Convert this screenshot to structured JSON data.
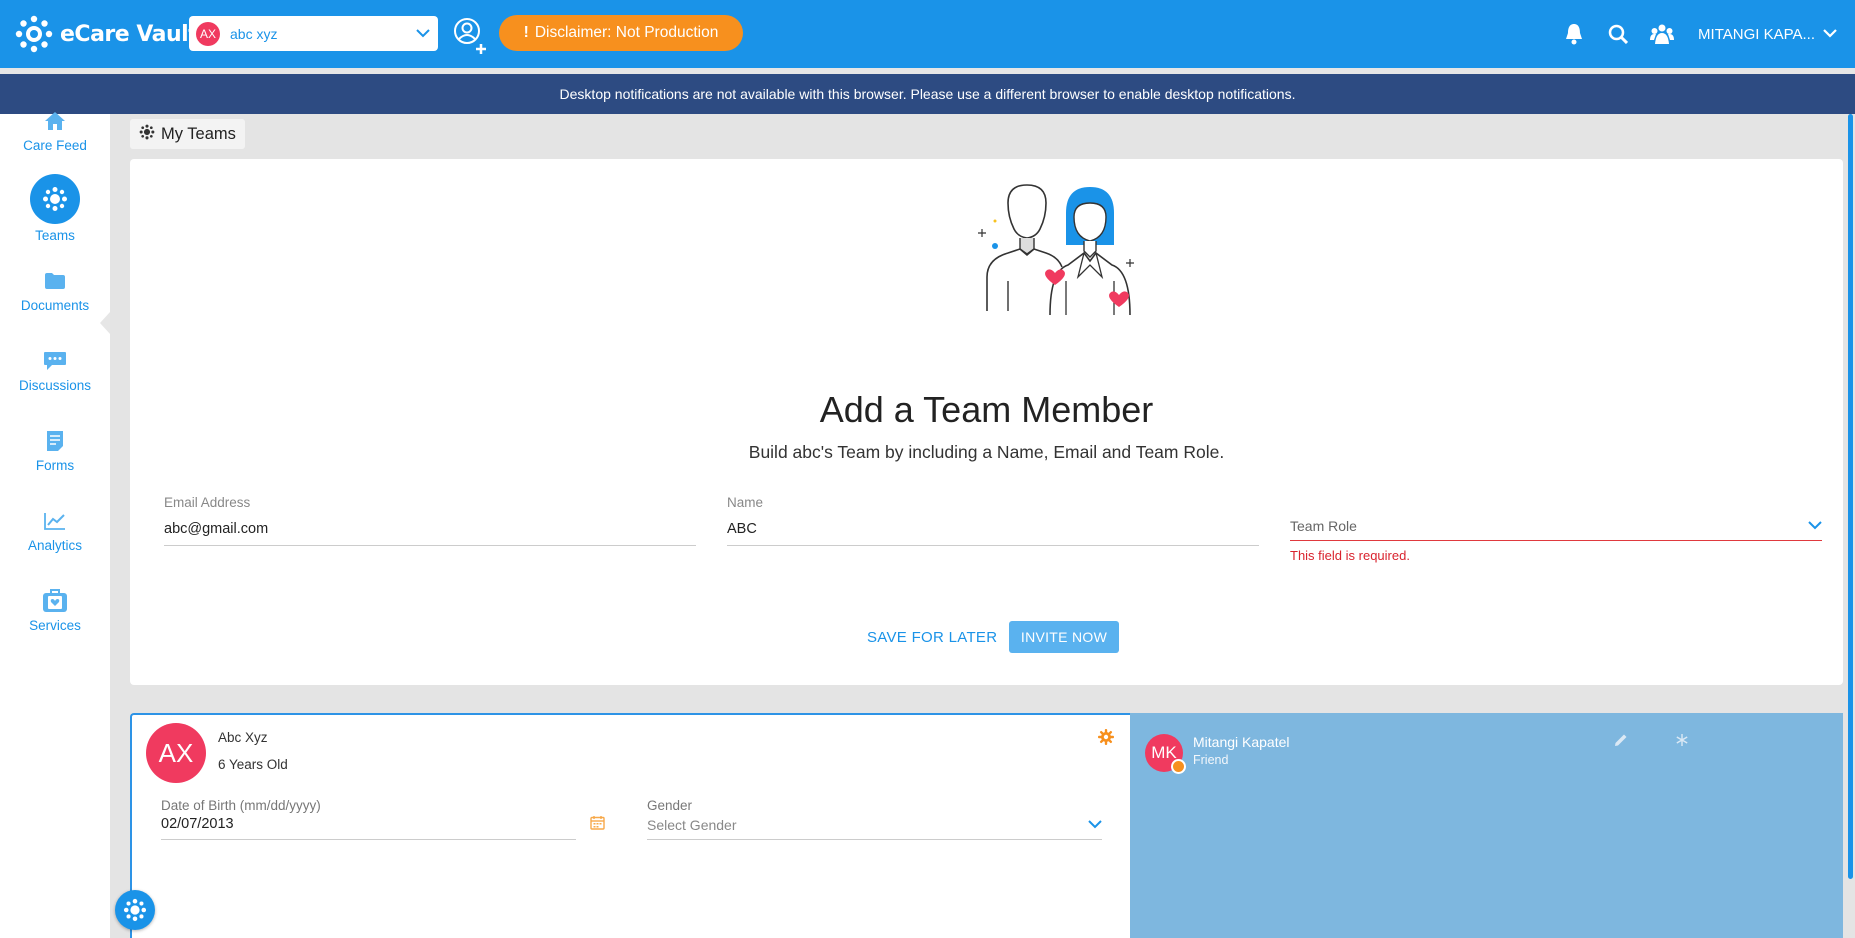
{
  "app": {
    "name": "eCare Vault"
  },
  "patient_select": {
    "initials": "AX",
    "name": "abc xyz"
  },
  "disclaimer": {
    "mark": "!",
    "label": "Disclaimer: Not Production"
  },
  "topbar": {
    "user_name": "MITANGI KAPA..."
  },
  "notification_banner": "Desktop notifications are not available with this browser. Please use a different browser to enable desktop notifications.",
  "sidebar": {
    "items": [
      {
        "label": "Care Feed",
        "icon": "home-icon",
        "active": false
      },
      {
        "label": "Teams",
        "icon": "teams-icon",
        "active": true
      },
      {
        "label": "Documents",
        "icon": "folder-icon",
        "active": false
      },
      {
        "label": "Discussions",
        "icon": "chat-icon",
        "active": false
      },
      {
        "label": "Forms",
        "icon": "form-icon",
        "active": false
      },
      {
        "label": "Analytics",
        "icon": "chart-icon",
        "active": false
      },
      {
        "label": "Services",
        "icon": "briefcase-icon",
        "active": false
      }
    ]
  },
  "breadcrumb": {
    "label": "My Teams"
  },
  "add_member": {
    "title": "Add a Team Member",
    "subtitle": "Build abc's Team by including a Name, Email and Team Role.",
    "email": {
      "label": "Email Address",
      "value": "abc@gmail.com"
    },
    "name": {
      "label": "Name",
      "value": "ABC"
    },
    "team_role": {
      "label": "Team Role",
      "value": "",
      "error": "This field is required."
    },
    "save_label": "SAVE FOR LATER",
    "invite_label": "INVITE NOW"
  },
  "profile": {
    "initials": "AX",
    "name": "Abc Xyz",
    "age": "6 Years Old",
    "dob": {
      "label": "Date of Birth (mm/dd/yyyy)",
      "value": "02/07/2013"
    },
    "gender": {
      "label": "Gender",
      "placeholder": "Select Gender"
    }
  },
  "team_member": {
    "initials": "MK",
    "name": "Mitangi Kapatel",
    "role": "Friend"
  },
  "colors": {
    "brand_blue": "#1a93e8",
    "banner_navy": "#2d4b82",
    "disclaimer_orange": "#f7901e",
    "avatar_pink": "#f03a5f",
    "error_red": "#d9232e",
    "member_panel": "#7eb7df"
  }
}
